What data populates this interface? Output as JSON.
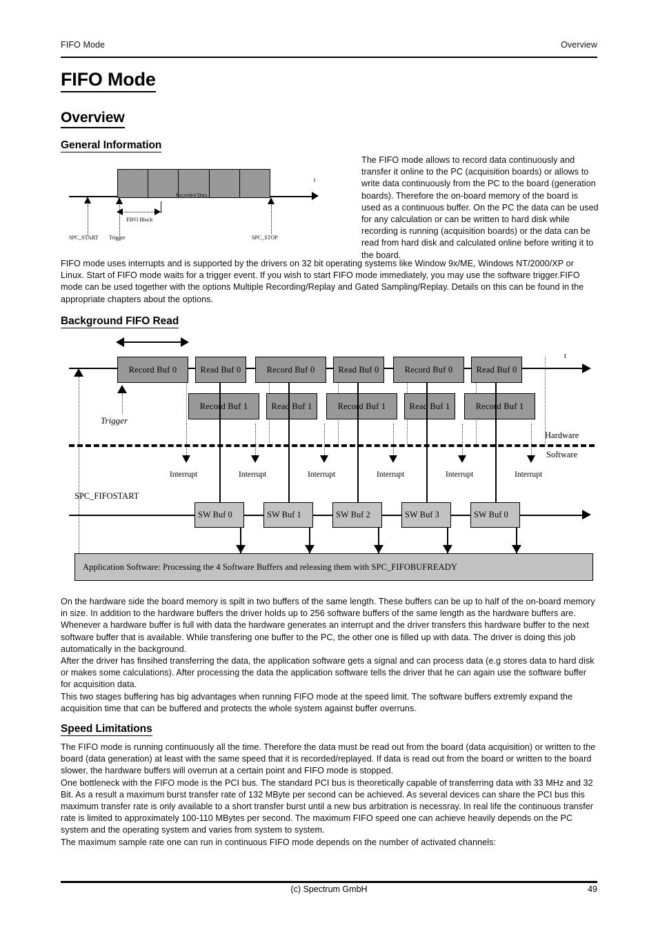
{
  "header": {
    "left": "FIFO Mode",
    "right": "Overview"
  },
  "titles": {
    "h1": "FIFO Mode",
    "h2": "Overview",
    "general_information": "General Information",
    "background_fifo_read": "Background FIFO Read",
    "speed_limitations": "Speed Limitations"
  },
  "paragraphs": {
    "intro_right": "The FIFO mode allows to record data continuously and transfer it online to the PC (acquisition boards) or allows to write data continuously from the PC to the board (generation boards). Therefore the on-board memory of the board is used as a continuous buffer. On the PC the data can be used for any calculation or can be written to hard disk while recording is running (acquisition boards) or the data can be read from hard disk and calculated online before writing it to the board.",
    "fifo_modes": "FIFO mode uses interrupts and is supported by the drivers on 32 bit operating systems like Window 9x/ME, Windows NT/2000/XP or Linux. Start of FIFO mode waits for a trigger event. If you wish to start FIFO mode immediately, you may use the software trigger.FIFO mode can be used together with the options Multiple Recording/Replay and Gated Sampling/Replay. Details on this can be found in the appropriate chapters about the options.",
    "hardware_side": "On the hardware side the board memory is spilt in two buffers of the same length. These buffers can be up to half of the on-board memory in size. In addition to the hardware buffers the driver holds up to 256 software buffers of the same length as the hardware buffers are. Whenever a hardware buffer is full with data the hardware generates an interrupt and the driver transfers this hardware buffer to the next software buffer that is available. While transfering one buffer to the PC, the other one is filled up with data. The driver is doing this job automatically in the background.\nAfter the driver has finsihed transferring the data, the application software gets a signal and can process data (e.g stores data to hard disk or makes some calculations). After processing the data the application software tells the driver that he can again use the software buffer for acquisition data.\nThis two stages buffering has big advantages when running FIFO mode at the speed limit. The software buffers extremly expand the acquisition time that can be buffered and protects the whole system against buffer overruns.",
    "speed_limitations": "The FIFO mode is running continuously all the time. Therefore the data must be read out from the board (data acquisition) or written to the board (data generation) at least with the same speed that it is recorded/replayed. If data is read out from the board or written to the board slower, the hardware buffers will overrun at a certain point and FIFO mode is stopped.\nOne bottleneck with the FIFO mode is the PCI bus. The standard PCI bus is theoretically capable of transferring data with 33 MHz and 32 Bit. As a result a maximum burst transfer rate of 132 MByte per second can be achieved. As several devices can share the PCI bus this maximum transfer rate is only available to a short transfer burst until a new bus arbitration is necessray. In real life the continuous transfer rate is limited to approximately 100-110 MBytes per second. The maximum FIFO speed one can achieve heavily depends on the PC system and the operating system and varies from system to system.\nThe maximum sample rate one can run in continuous FIFO mode depends on the number of activated channels:"
  },
  "diagram_general": {
    "t_axis_label": "t",
    "recorded_data_label": "Recorded Data",
    "fifo_block_label": "FIFO Block",
    "spc_start_label": "SPC_START",
    "trigger_label": "Trigger",
    "spc_stop_label": "SPC_STOP",
    "block_fill": "#999999",
    "cell_count": 5
  },
  "diagram_background_fifo": {
    "t_axis_label": "t",
    "trigger_label": "Trigger",
    "hardware_label": "Hardware",
    "software_label": "Software",
    "fifostart_label": "SPC_FIFOSTART",
    "interrupt_label": "Interrupt",
    "interrupt_count": 6,
    "hw_row_top": [
      "Record Buf 0",
      "Read Buf 0",
      "Record Buf 0",
      "Read Buf 0",
      "Record Buf 0",
      "Read Buf 0"
    ],
    "hw_row_bottom": [
      "Record Buf 1",
      "Read Buf 1",
      "Record Buf 1",
      "Read Buf 1",
      "Record Buf 1"
    ],
    "sw_buffers": [
      "SW Buf 0",
      "SW Buf 1",
      "SW Buf 2",
      "SW Buf 3",
      "SW Buf 0"
    ],
    "app_bar_label": "Application Software: Processing the 4 Software Buffers and releasing them with SPC_FIFOBUFREADY",
    "hw_box_fill": "#999999",
    "sw_box_fill": "#c2c2c2"
  },
  "footer": {
    "center": "(c) Spectrum GmbH",
    "page_number": "49"
  }
}
